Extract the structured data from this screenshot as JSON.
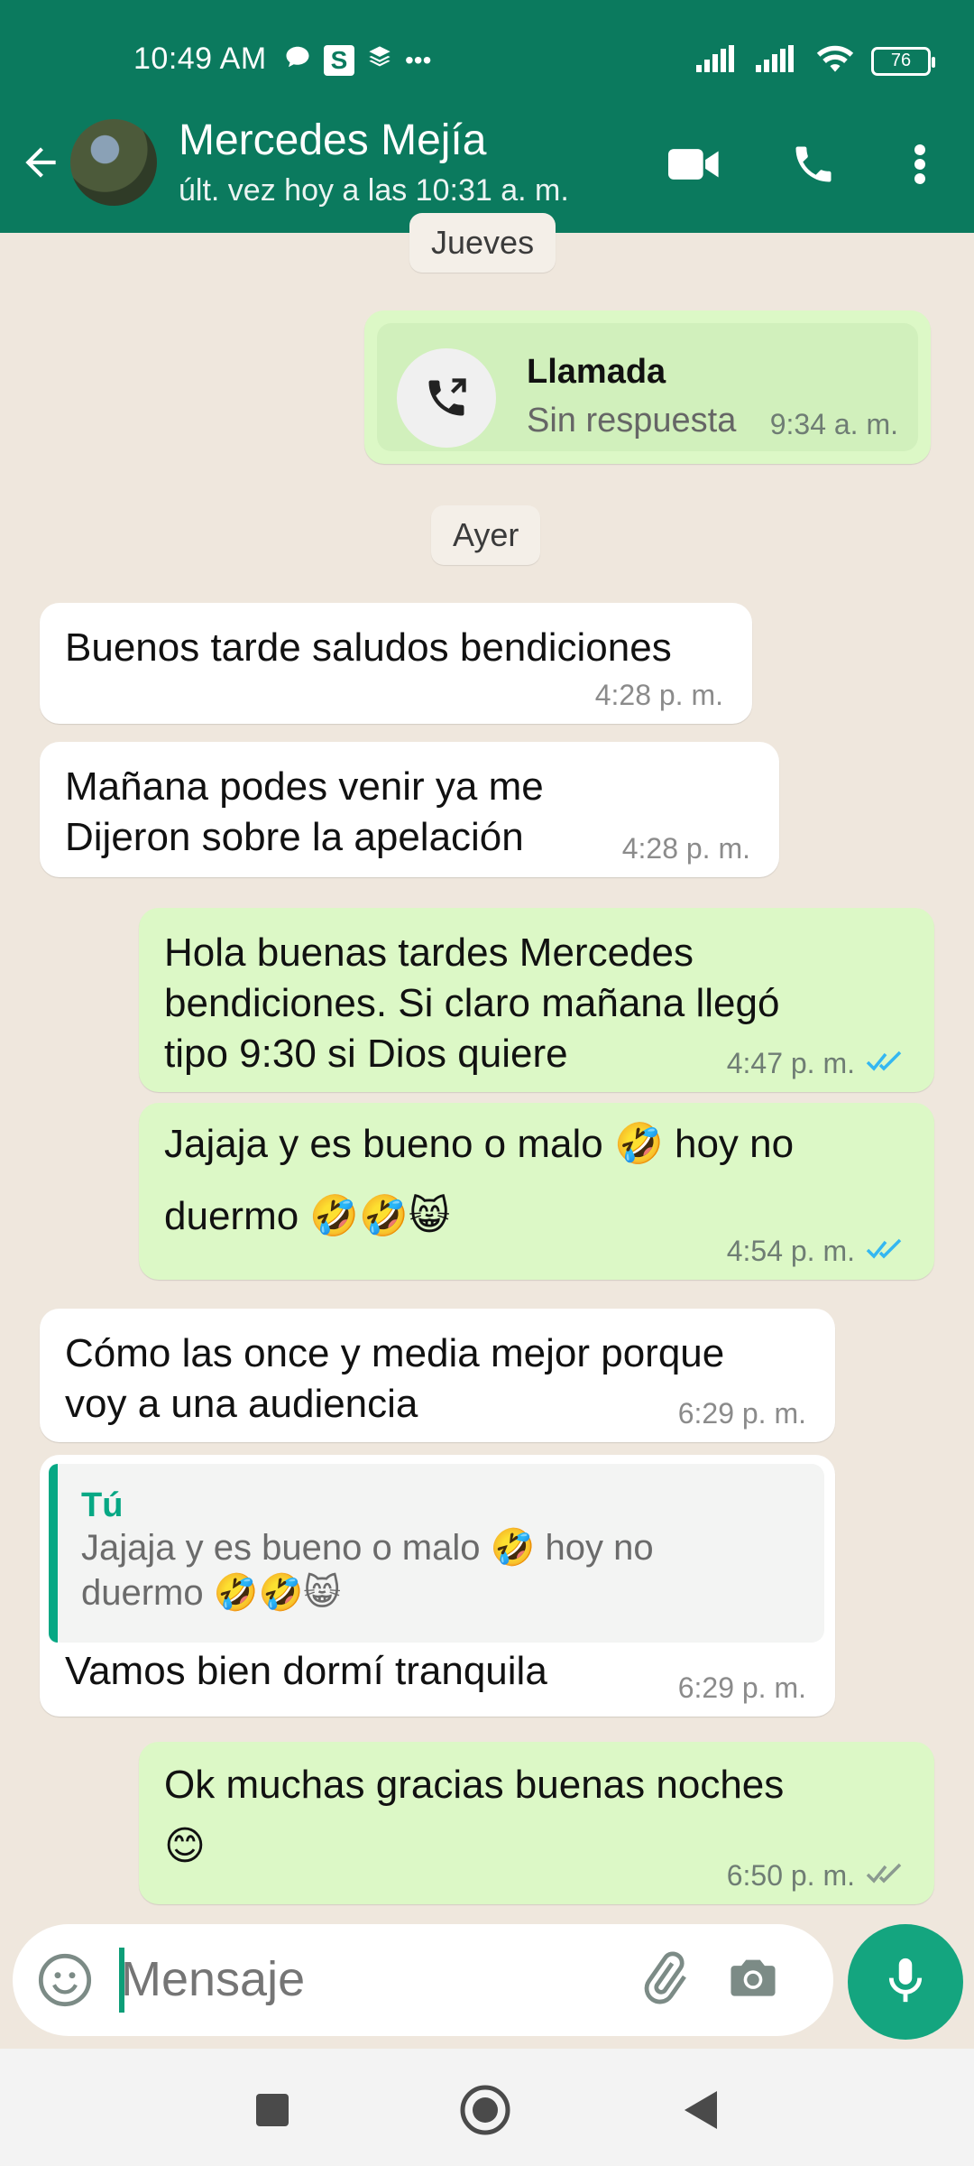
{
  "status": {
    "time": "10:49 AM",
    "battery": "76",
    "extra": "•••"
  },
  "header": {
    "contact_name": "Mercedes Mejía",
    "last_seen": "últ. vez hoy a las 10:31 a. m."
  },
  "chips": {
    "day1": "Jueves",
    "day2": "Ayer"
  },
  "call": {
    "title": "Llamada",
    "subtitle": "Sin respuesta",
    "time": "9:34 a. m."
  },
  "messages": [
    {
      "dir": "in",
      "text": "Buenos tarde saludos bendiciones",
      "time": "4:28 p. m."
    },
    {
      "dir": "in",
      "text": "Mañana podes venir ya me\nDijeron sobre la apelación",
      "time": "4:28 p. m."
    },
    {
      "dir": "out",
      "text": "Hola buenas tardes Mercedes\nbendiciones. Si claro mañana llegó\ntipo 9:30 si Dios quiere",
      "time": "4:47 p. m."
    },
    {
      "dir": "out",
      "text": "Jajaja y es bueno o malo 🤣 hoy no\nduermo 🤣🤣😸",
      "time": "4:54 p. m."
    },
    {
      "dir": "in",
      "text": "Cómo las once y media mejor porque\nvoy a una audiencia",
      "time": "6:29 p. m."
    },
    {
      "dir": "in",
      "quote_author": "Tú",
      "quote_text": "Jajaja y es bueno o malo 🤣 hoy no\nduermo 🤣🤣😸",
      "text": "Vamos bien dormí tranquila",
      "time": "6:29 p. m."
    },
    {
      "dir": "out",
      "text": "Ok muchas gracias buenas noches\n😊",
      "time": "6:50 p. m."
    }
  ],
  "composer": {
    "placeholder": "Mensaje"
  },
  "colors": {
    "header": "#0b7a5e",
    "outgoing": "#dcf8c6",
    "incoming": "#ffffff",
    "read_tick": "#34b7f1",
    "accent": "#14a57f"
  }
}
